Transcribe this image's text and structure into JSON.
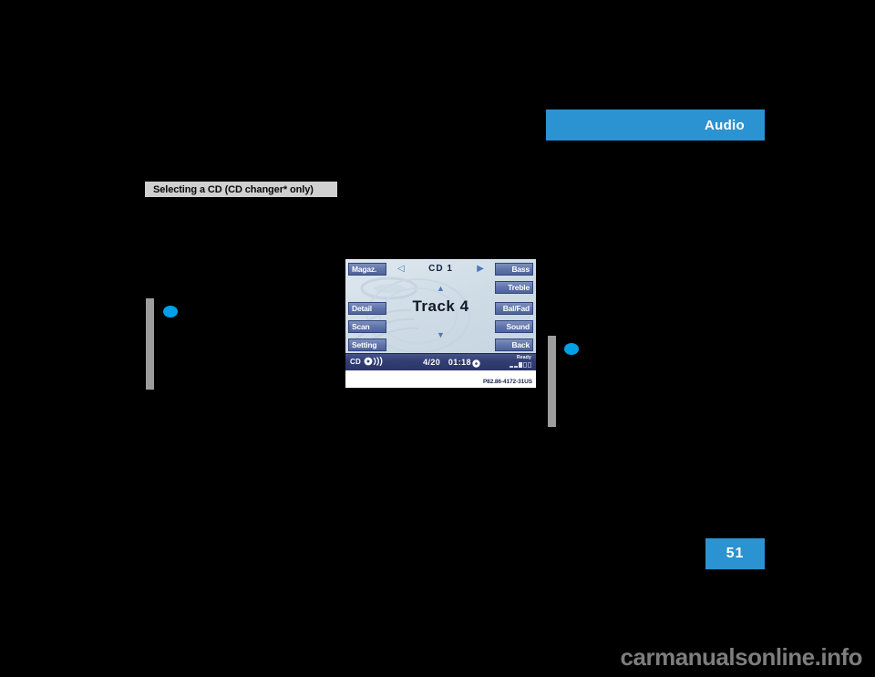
{
  "page": {
    "number": "51",
    "section_tab": "Audio",
    "heading": "Selecting a CD (CD changer* only)",
    "watermark": "carmanualsonline.info",
    "background_color": "#000000",
    "accent_color": "#2b93d1"
  },
  "figure": {
    "caption": "P82.86-4172-31US",
    "display": {
      "header": "CD 1",
      "main_text": "Track 4",
      "left_buttons": [
        {
          "label": "Magaz."
        },
        {
          "label": "Detail"
        },
        {
          "label": "Scan"
        },
        {
          "label": "Setting"
        }
      ],
      "right_buttons": [
        {
          "label": "Bass"
        },
        {
          "label": "Treble"
        },
        {
          "label": "Bal/Fad"
        },
        {
          "label": "Sound"
        },
        {
          "label": "Back"
        }
      ],
      "nav": {
        "left": "◁",
        "right": "▶",
        "up": "▲",
        "down": "▼"
      },
      "status_bar": {
        "source": "CD",
        "track_position": "4/20",
        "elapsed_time": "01:18",
        "magazine_label": "Ready",
        "magazine_slots": [
          "dash",
          "dash",
          "filled",
          "empty",
          "empty"
        ]
      }
    }
  }
}
